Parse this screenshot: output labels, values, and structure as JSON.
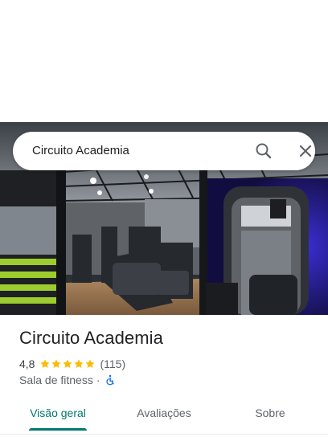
{
  "search": {
    "query": "Circuito Academia",
    "search_icon": "search-icon",
    "close_icon": "close-icon"
  },
  "hero": {
    "image": "gym-interior-photo"
  },
  "place": {
    "name": "Circuito Academia",
    "rating": "4,8",
    "rating_value": 4.8,
    "stars": 5,
    "review_count": "(115)",
    "category": "Sala de fitness",
    "separator": "·",
    "accessibility_icon": "wheelchair-icon"
  },
  "tabs": [
    {
      "label": "Visão geral",
      "active": true
    },
    {
      "label": "Avaliações",
      "active": false
    },
    {
      "label": "Sobre",
      "active": false
    }
  ],
  "colors": {
    "accent": "#01796f",
    "star": "#fbbc04",
    "accessibility": "#1a73e8"
  }
}
